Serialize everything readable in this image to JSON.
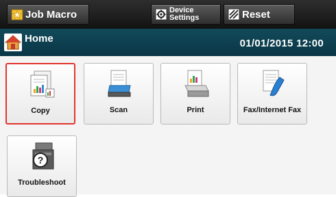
{
  "topbar": {
    "job_macro_label": "Job Macro",
    "device_settings_label": "Device\nSettings",
    "reset_label": "Reset"
  },
  "homebar": {
    "title": "Home",
    "datetime": "01/01/2015 12:00"
  },
  "tiles": [
    {
      "label": "Copy",
      "icon": "copy-icon",
      "selected": true
    },
    {
      "label": "Scan",
      "icon": "scan-icon",
      "selected": false
    },
    {
      "label": "Print",
      "icon": "print-icon",
      "selected": false
    },
    {
      "label": "Fax/Internet Fax",
      "icon": "fax-icon",
      "selected": false
    },
    {
      "label": "Troubleshoot",
      "icon": "troubleshoot-icon",
      "selected": false
    }
  ],
  "colors": {
    "topbar": "#1f1f1f",
    "homebar": "#0e4050",
    "selection": "#e2332e",
    "content_bg": "#f4f4f4"
  }
}
